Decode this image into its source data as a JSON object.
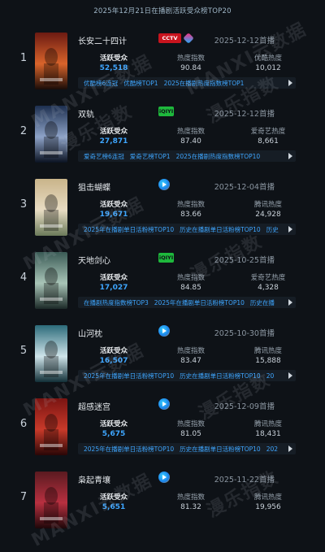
{
  "header": {
    "title": "2025年12月21日在播剧活跃受众榜TOP20"
  },
  "watermarks": [
    "MANXI云数据",
    "漫乐指数",
    "MANXI云数据",
    "漫乐指数",
    "MANXI云数据",
    "漫乐指数"
  ],
  "metric_labels": {
    "active": "活跃受众",
    "heat": "热度指数"
  },
  "rows": [
    {
      "rank": "1",
      "title": "长安二十四计",
      "platforms": [
        "cctv",
        "youku"
      ],
      "date": "2025-12-12",
      "date_suffix": "首播",
      "active": "52,518",
      "heat": "90.84",
      "platform_heat_label": "优酷热度",
      "platform_heat": "10,012",
      "tags": [
        "优酷榜6连冠",
        "优酷榜TOP1",
        "2025在播剧热度指数榜TOP1"
      ],
      "poster_colors": [
        "#6b1a12",
        "#d9642b",
        "#1a0c08"
      ]
    },
    {
      "rank": "2",
      "title": "双轨",
      "platforms": [
        "iqiyi"
      ],
      "date": "2025-12-12",
      "date_suffix": "首播",
      "active": "27,871",
      "heat": "87.40",
      "platform_heat_label": "爱奇艺热度",
      "platform_heat": "8,661",
      "tags": [
        "爱奇艺榜6连冠",
        "爱奇艺榜TOP1",
        "2025在播剧热度指数榜TOP10"
      ],
      "poster_colors": [
        "#1d2f4f",
        "#8ea3c8",
        "#0b1322"
      ]
    },
    {
      "rank": "3",
      "title": "狙击蝴蝶",
      "platforms": [
        "tencent"
      ],
      "date": "2025-12-04",
      "date_suffix": "首播",
      "active": "19,671",
      "heat": "83.66",
      "platform_heat_label": "腾讯热度",
      "platform_heat": "24,928",
      "tags": [
        "2025年在播剧单日活粉榜TOP10",
        "历史在播剧单日活粉榜TOP10",
        "历史"
      ],
      "poster_colors": [
        "#c9b48a",
        "#e8dcc3",
        "#6b7a5a"
      ]
    },
    {
      "rank": "4",
      "title": "天地剑心",
      "platforms": [
        "iqiyi"
      ],
      "date": "2025-10-25",
      "date_suffix": "首播",
      "active": "17,027",
      "heat": "84.85",
      "platform_heat_label": "爱奇艺热度",
      "platform_heat": "4,328",
      "tags": [
        "在播剧热度指数榜TOP3",
        "2025年在播剧单日活粉榜TOP10",
        "历史在播"
      ],
      "poster_colors": [
        "#3a5a55",
        "#a9c5b8",
        "#1c2a28"
      ]
    },
    {
      "rank": "5",
      "title": "山河枕",
      "platforms": [
        "tencent"
      ],
      "date": "2025-10-30",
      "date_suffix": "首播",
      "active": "16,507",
      "heat": "83.47",
      "platform_heat_label": "腾讯热度",
      "platform_heat": "15,888",
      "tags": [
        "2025年在播剧单日活粉榜TOP10",
        "历史在播剧单日活粉榜TOP10",
        "20"
      ],
      "poster_colors": [
        "#2c6b7a",
        "#cfe4ea",
        "#123038"
      ]
    },
    {
      "rank": "6",
      "title": "超感迷宫",
      "platforms": [
        "tencent"
      ],
      "date": "2025-12-09",
      "date_suffix": "首播",
      "active": "5,675",
      "heat": "81.05",
      "platform_heat_label": "腾讯热度",
      "platform_heat": "18,431",
      "tags": [
        "2025年在播剧单日活粉榜TOP10",
        "历史在播剧单日活粉榜TOP10",
        "202"
      ],
      "poster_colors": [
        "#7a1412",
        "#c83a2a",
        "#2a0606"
      ]
    },
    {
      "rank": "7",
      "title": "枭起青壤",
      "platforms": [
        "tencent"
      ],
      "date": "2025-11-22",
      "date_suffix": "首播",
      "active": "5,651",
      "heat": "81.32",
      "platform_heat_label": "腾讯热度",
      "platform_heat": "19,956",
      "tags": [],
      "poster_colors": [
        "#5a1a20",
        "#b83040",
        "#1e0709"
      ]
    }
  ]
}
